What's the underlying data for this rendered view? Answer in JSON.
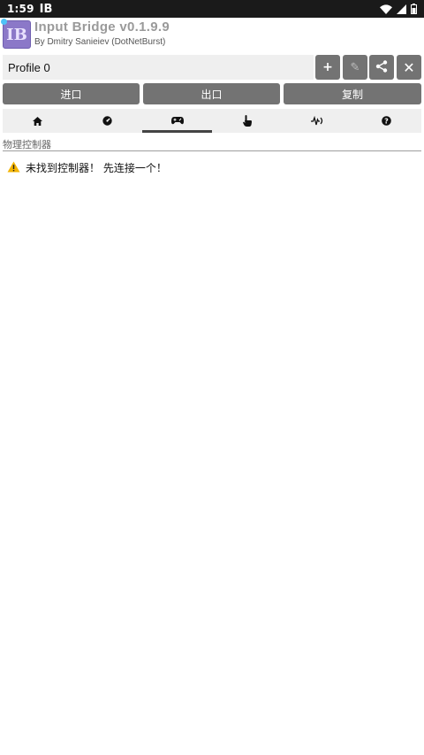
{
  "status_bar": {
    "time": "1:59",
    "app_icon_text": "IB",
    "icons": [
      "wifi-icon",
      "signal-icon",
      "battery-icon"
    ]
  },
  "header": {
    "logo_text": "IB",
    "title": "Input Bridge v0.1.9.9",
    "subtitle": "By Dmitry Sanieiev (DotNetBurst)"
  },
  "profile": {
    "name": "Profile 0",
    "buttons": {
      "add": "+",
      "edit": "✎",
      "share_icon": "share-icon",
      "close": "✕"
    }
  },
  "actions": {
    "import_label": "进口",
    "export_label": "出口",
    "copy_label": "复制"
  },
  "tabs": [
    {
      "icon": "home-icon",
      "active": false
    },
    {
      "icon": "speedometer-icon",
      "active": false
    },
    {
      "icon": "gamepad-icon",
      "active": true
    },
    {
      "icon": "touch-icon",
      "active": false
    },
    {
      "icon": "vibration-icon",
      "active": false
    },
    {
      "icon": "help-icon",
      "active": false
    }
  ],
  "section": {
    "label": "物理控制器"
  },
  "warning": {
    "icon": "warning-icon",
    "text": "未找到控制器！ 先连接一个！"
  },
  "colors": {
    "button_gray": "#737373",
    "field_bg": "#efefef",
    "warning_yellow": "#f4b400",
    "logo_purple": "#8b78c8"
  }
}
